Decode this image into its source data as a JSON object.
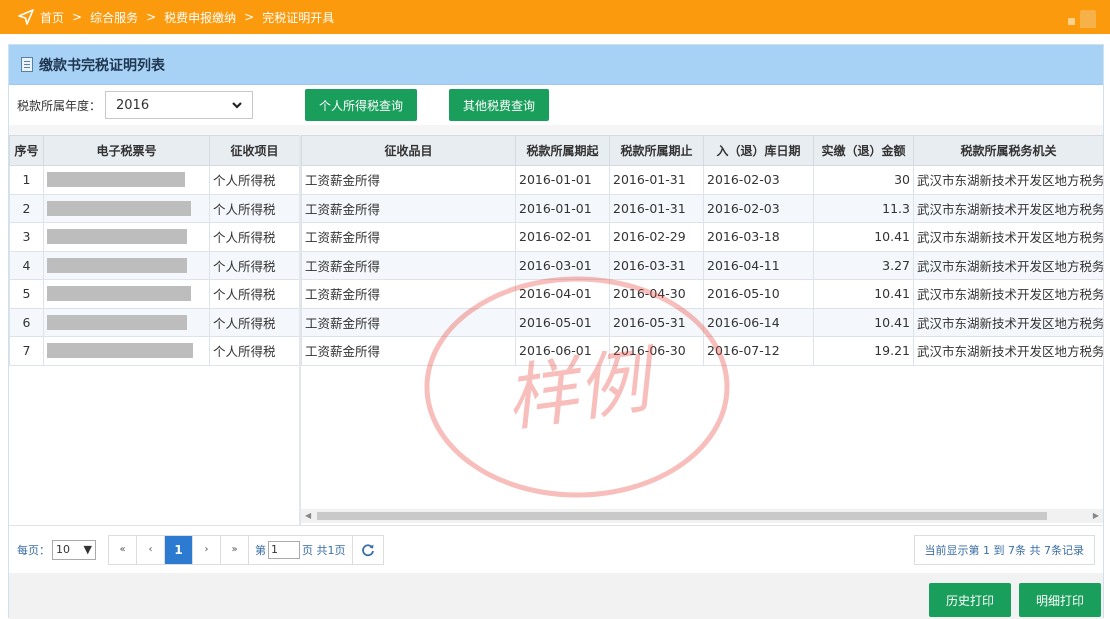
{
  "breadcrumb": [
    "首页",
    "综合服务",
    "税费申报缴纳",
    "完税证明开具"
  ],
  "breadcrumb_separator": ">",
  "panel": {
    "title": "缴款书完税证明列表"
  },
  "filter": {
    "year_label": "税款所属年度：",
    "year_value": "2016",
    "btn_iit": "个人所得税查询",
    "btn_other": "其他税费查询"
  },
  "columns": {
    "left": [
      "序号",
      "电子税票号",
      "征收项目"
    ],
    "right": [
      "征收品目",
      "税款所属期起",
      "税款所属期止",
      "入（退）库日期",
      "实缴（退）金额",
      "税款所属税务机关"
    ]
  },
  "rows": [
    {
      "no": "1",
      "item": "个人所得税",
      "category": "工资薪金所得",
      "start": "2016-01-01",
      "end": "2016-01-31",
      "date": "2016-02-03",
      "amount": "30",
      "office": "武汉市东湖新技术开发区地方税务局"
    },
    {
      "no": "2",
      "item": "个人所得税",
      "category": "工资薪金所得",
      "start": "2016-01-01",
      "end": "2016-01-31",
      "date": "2016-02-03",
      "amount": "11.3",
      "office": "武汉市东湖新技术开发区地方税务局"
    },
    {
      "no": "3",
      "item": "个人所得税",
      "category": "工资薪金所得",
      "start": "2016-02-01",
      "end": "2016-02-29",
      "date": "2016-03-18",
      "amount": "10.41",
      "office": "武汉市东湖新技术开发区地方税务局"
    },
    {
      "no": "4",
      "item": "个人所得税",
      "category": "工资薪金所得",
      "start": "2016-03-01",
      "end": "2016-03-31",
      "date": "2016-04-11",
      "amount": "3.27",
      "office": "武汉市东湖新技术开发区地方税务局"
    },
    {
      "no": "5",
      "item": "个人所得税",
      "category": "工资薪金所得",
      "start": "2016-04-01",
      "end": "2016-04-30",
      "date": "2016-05-10",
      "amount": "10.41",
      "office": "武汉市东湖新技术开发区地方税务局"
    },
    {
      "no": "6",
      "item": "个人所得税",
      "category": "工资薪金所得",
      "start": "2016-05-01",
      "end": "2016-05-31",
      "date": "2016-06-14",
      "amount": "10.41",
      "office": "武汉市东湖新技术开发区地方税务局"
    },
    {
      "no": "7",
      "item": "个人所得税",
      "category": "工资薪金所得",
      "start": "2016-06-01",
      "end": "2016-06-30",
      "date": "2016-07-12",
      "amount": "19.21",
      "office": "武汉市东湖新技术开发区地方税务局"
    }
  ],
  "pager": {
    "per_page_label": "每页：",
    "per_page_value": "10",
    "first": "«",
    "prev": "‹",
    "current": "1",
    "next": "›",
    "last": "»",
    "page_prefix": "第",
    "page_input": "1",
    "page_suffix": "页 共1页",
    "summary": "当前显示第 1 到 7条 共 7条记录"
  },
  "footer": {
    "btn_history": "历史打印",
    "btn_detail": "明细打印"
  },
  "watermark": "样例",
  "colors": {
    "topbar": "#fa9a0c",
    "header": "#a8d2f5",
    "button_green": "#1a9e5c",
    "pager_active": "#2d7bd1",
    "stamp": "#e8453c"
  }
}
